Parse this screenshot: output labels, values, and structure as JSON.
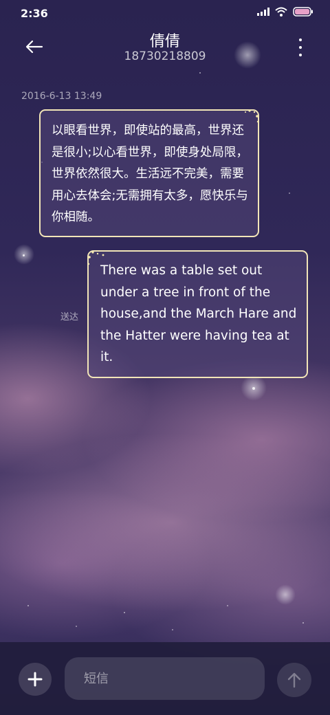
{
  "status_bar": {
    "time": "2:36",
    "icons": [
      "signal-icon",
      "wifi-icon",
      "battery-icon"
    ]
  },
  "header": {
    "contact_name": "倩倩",
    "contact_number": "18730218809",
    "back_icon": "arrow-left-icon",
    "menu_icon": "more-vertical-icon"
  },
  "conversation": {
    "timestamp": "2016-6-13 13:49",
    "incoming_message": "以眼看世界，即使站的最高，世界还是很小;以心看世界，即使身处局限，世界依然很大。生活远不完美，需要用心去体会;无需拥有太多，愿快乐与你相随。",
    "outgoing_message": "There was a table set out under a tree in front of the house,and the March Hare and the Hatter were having tea at it.",
    "outgoing_status": "送达"
  },
  "composer": {
    "placeholder": "短信",
    "add_icon": "plus-icon",
    "send_icon": "arrow-up-icon"
  },
  "colors": {
    "bubble_border": "#f3e6b8",
    "background_top": "#2a2350",
    "background_glow": "#d6a0be"
  }
}
